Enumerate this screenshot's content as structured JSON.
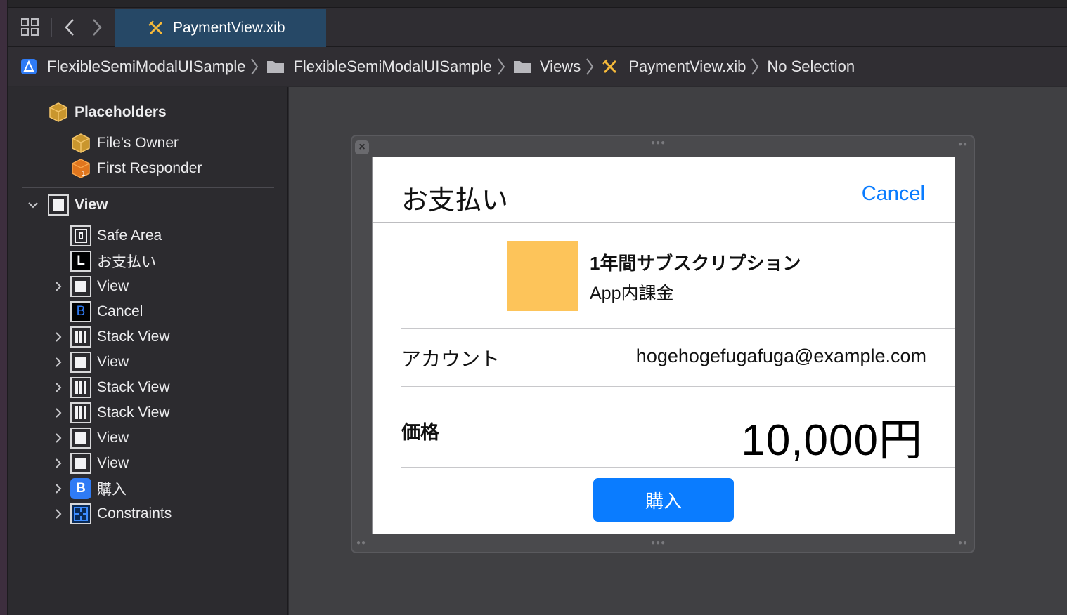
{
  "tab": {
    "label": "PaymentView.xib"
  },
  "breadcrumbs": [
    {
      "label": "FlexibleSemiModalUISample",
      "icon": "app-project-icon"
    },
    {
      "label": "FlexibleSemiModalUISample",
      "icon": "folder-icon"
    },
    {
      "label": "Views",
      "icon": "folder-icon"
    },
    {
      "label": "PaymentView.xib",
      "icon": "xib-icon"
    },
    {
      "label": "No Selection",
      "icon": ""
    }
  ],
  "outline": {
    "placeholders": "Placeholders",
    "files_owner": "File's Owner",
    "first_responder": "First Responder",
    "view": "View",
    "children": [
      {
        "label": "Safe Area",
        "icon": "safe-area-icon",
        "expandable": false
      },
      {
        "label": "お支払い",
        "icon": "label-icon",
        "expandable": false
      },
      {
        "label": "View",
        "icon": "view-icon",
        "expandable": true
      },
      {
        "label": "Cancel",
        "icon": "button-icon",
        "expandable": false
      },
      {
        "label": "Stack View",
        "icon": "stack-view-icon",
        "expandable": true
      },
      {
        "label": "View",
        "icon": "view-icon",
        "expandable": true
      },
      {
        "label": "Stack View",
        "icon": "stack-view-icon",
        "expandable": true
      },
      {
        "label": "Stack View",
        "icon": "stack-view-icon",
        "expandable": true
      },
      {
        "label": "View",
        "icon": "view-icon",
        "expandable": true
      },
      {
        "label": "View",
        "icon": "view-icon",
        "expandable": true
      },
      {
        "label": "購入",
        "icon": "button-icon",
        "expandable": true
      },
      {
        "label": "Constraints",
        "icon": "constraints-icon",
        "expandable": true
      }
    ]
  },
  "payment": {
    "title": "お支払い",
    "cancel": "Cancel",
    "product_name": "1年間サブスクリプション",
    "product_type": "App内課金",
    "account_label": "アカウント",
    "account_value": "hogehogefugafuga@example.com",
    "price_label": "価格",
    "price_value": "10,000円",
    "buy_button": "購入",
    "thumbnail_color": "#fdc45a",
    "accent_color": "#0a7cff"
  }
}
